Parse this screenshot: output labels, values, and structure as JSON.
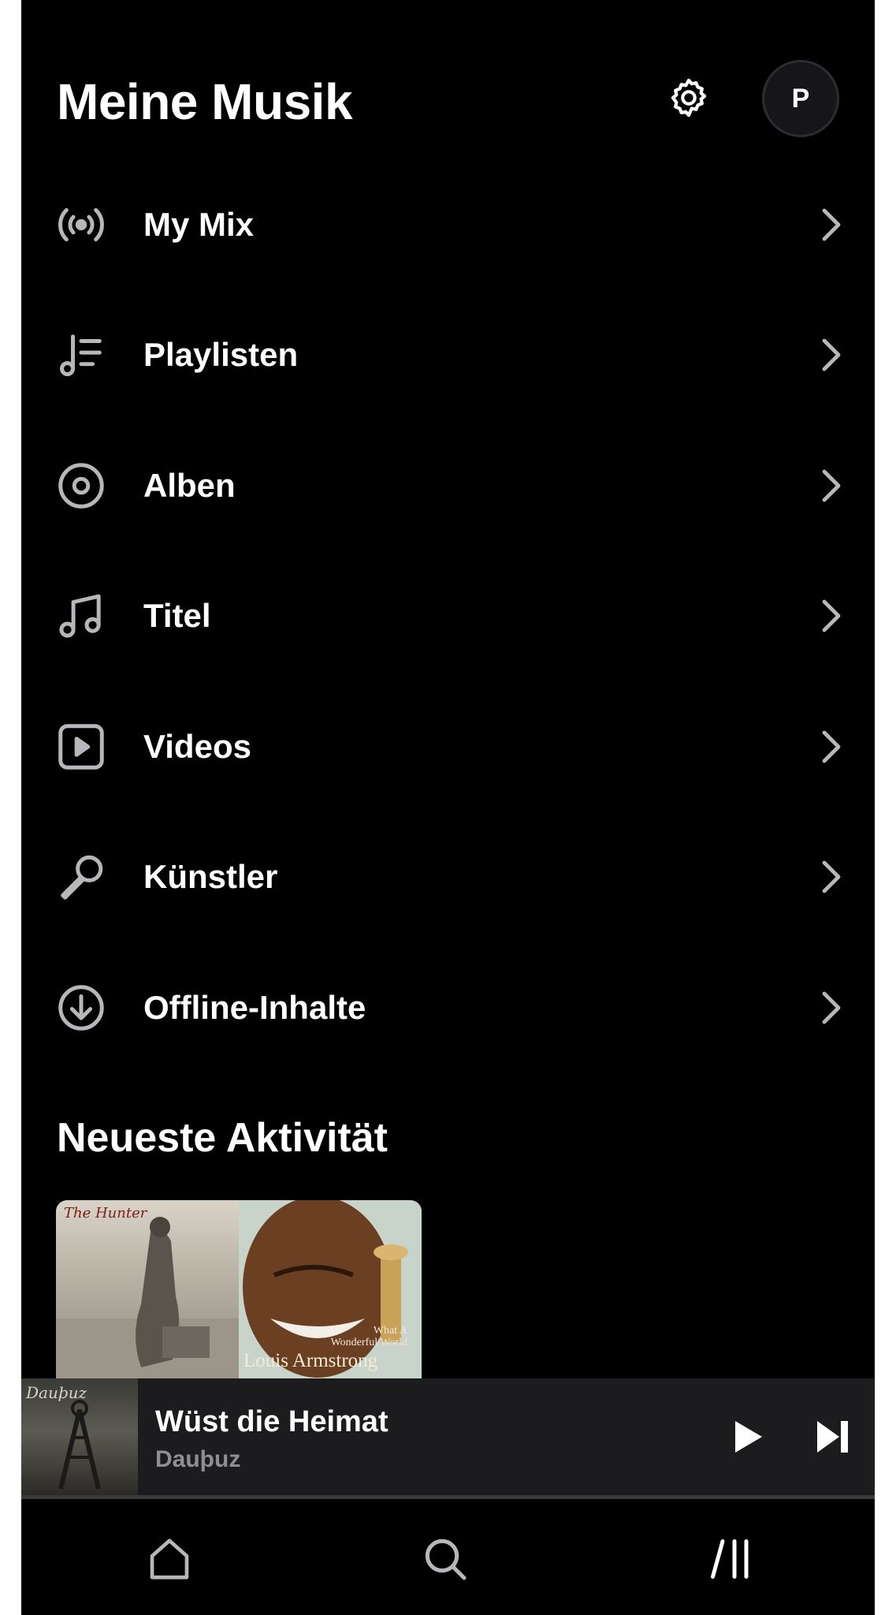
{
  "header": {
    "title": "Meine Musik",
    "avatar_initial": "P"
  },
  "menu": {
    "items": [
      {
        "label": "My Mix",
        "icon": "radio-broadcast-icon"
      },
      {
        "label": "Playlisten",
        "icon": "playlist-icon"
      },
      {
        "label": "Alben",
        "icon": "album-disc-icon"
      },
      {
        "label": "Titel",
        "icon": "music-note-icon"
      },
      {
        "label": "Videos",
        "icon": "video-play-icon"
      },
      {
        "label": "Künstler",
        "icon": "microphone-icon"
      },
      {
        "label": "Offline-Inhalte",
        "icon": "download-icon"
      }
    ]
  },
  "activity": {
    "section_title": "Neueste Aktivität",
    "covers": [
      {
        "text": "The Hunter"
      },
      {
        "subtitle_line1": "What A",
        "subtitle_line2": "Wonderful World",
        "text": "Louis Armstrong"
      }
    ]
  },
  "now_playing": {
    "title": "Wüst die Heimat",
    "artist": "Dauþuz",
    "art_text": "Dauþuz",
    "progress": 0.0
  },
  "tabbar": {
    "tabs": [
      {
        "icon": "home-icon"
      },
      {
        "icon": "search-icon"
      },
      {
        "icon": "library-icon"
      }
    ]
  },
  "colors": {
    "background": "#000000",
    "text": "#ffffff",
    "secondary_text": "#8e8e93",
    "icon_gray": "#b7b7bb",
    "mini_player_bg": "#1c1c1e"
  }
}
